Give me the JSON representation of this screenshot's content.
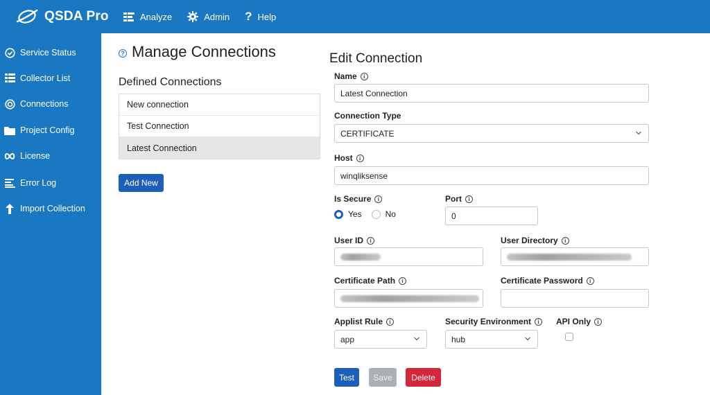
{
  "app": {
    "title": "QSDA Pro"
  },
  "topnav": [
    {
      "label": "Analyze",
      "icon": "analyze-icon"
    },
    {
      "label": "Admin",
      "icon": "gear-icon"
    },
    {
      "label": "Help",
      "icon": "question-icon"
    }
  ],
  "sidebar": {
    "items": [
      {
        "label": "Service Status",
        "icon": "status-icon"
      },
      {
        "label": "Collector List",
        "icon": "list-icon"
      },
      {
        "label": "Connections",
        "icon": "connections-icon"
      },
      {
        "label": "Project Config",
        "icon": "folder-icon"
      },
      {
        "label": "License",
        "icon": "infinity-icon"
      },
      {
        "label": "Error Log",
        "icon": "log-icon"
      },
      {
        "label": "Import Collection",
        "icon": "arrow-up-icon"
      }
    ]
  },
  "main": {
    "title": "Manage Connections",
    "defined_label": "Defined Connections",
    "connections": [
      "New connection",
      "Test Connection",
      "Latest Connection"
    ],
    "selected_connection": "Latest Connection",
    "add_new_label": "Add New"
  },
  "edit": {
    "title": "Edit Connection",
    "name_label": "Name",
    "name_value": "Latest Connection",
    "type_label": "Connection Type",
    "type_value": "CERTIFICATE",
    "host_label": "Host",
    "host_value": "winqliksense",
    "secure_label": "Is Secure",
    "secure_yes": "Yes",
    "secure_no": "No",
    "secure_value": "Yes",
    "port_label": "Port",
    "port_value": "0",
    "userid_label": "User ID",
    "userdir_label": "User Directory",
    "certpath_label": "Certificate Path",
    "certpass_label": "Certificate Password",
    "applist_label": "Applist Rule",
    "applist_value": "app",
    "secenv_label": "Security Environment",
    "secenv_value": "hub",
    "apionly_label": "API Only",
    "test_label": "Test",
    "save_label": "Save",
    "delete_label": "Delete"
  },
  "colors": {
    "brand": "#1a78c2",
    "primary_button": "#1d5fb8",
    "danger_button": "#d4273a",
    "disabled_button": "#aab0b6"
  }
}
